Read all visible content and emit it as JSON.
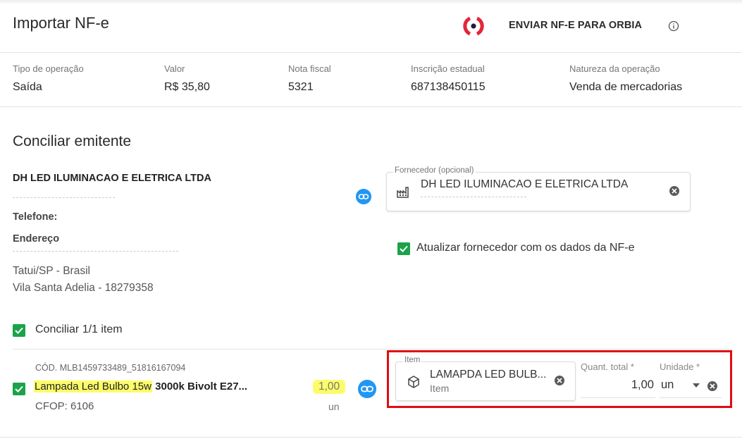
{
  "header": {
    "title": "Importar NF-e",
    "send_label": "ENVIAR NF-E PARA ORBIA",
    "icons": {
      "logo": "orbia-logo",
      "info": "info-icon"
    },
    "brand_color": "#e4253a"
  },
  "summary": [
    {
      "label": "Tipo de operação",
      "value": "Saída"
    },
    {
      "label": "Valor",
      "value": "R$ 35,80"
    },
    {
      "label": "Nota fiscal",
      "value": "5321"
    },
    {
      "label": "Inscrição estadual",
      "value": "687138450115"
    },
    {
      "label": "Natureza da operação",
      "value": "Venda de mercadorias"
    }
  ],
  "emitente": {
    "section_title": "Conciliar emitente",
    "name": "DH LED ILUMINACAO E ELETRICA LTDA",
    "phone_label": "Telefone:",
    "address_label": "Endereço",
    "city": "Tatui/SP - Brasil",
    "district": "Vila Santa Adelia - 18279358"
  },
  "supplier_field": {
    "label": "Fornecedor (opcional)",
    "value": "DH LED ILUMINACAO E ELETRICA LTDA",
    "icon": "factory-icon"
  },
  "update_supplier": {
    "label": "Atualizar fornecedor com os dados da NF-e",
    "checked": true
  },
  "items_toggle": {
    "label": "Conciliar 1/1 item",
    "checked": true
  },
  "item_row": {
    "code": "CÓD. MLB1459733489_51816167094",
    "desc_highlighted": "Lampada Led Bulbo 15w",
    "desc_rest": " 3000k Bivolt E27...",
    "cfop": "CFOP: 6106",
    "qty": "1,00",
    "unit": "un",
    "checked": true,
    "highlight_color": "#fcfc6a"
  },
  "item_match": {
    "item_field_label": "Item",
    "item_name": "LAMAPDA LED BULB...",
    "item_type": "Item",
    "qty_label": "Quant. total *",
    "qty_value": "1,00",
    "qty_unit": "un",
    "unit_label": "Unidade *",
    "unit_value": "un",
    "annotation_color": "#e10c12"
  }
}
